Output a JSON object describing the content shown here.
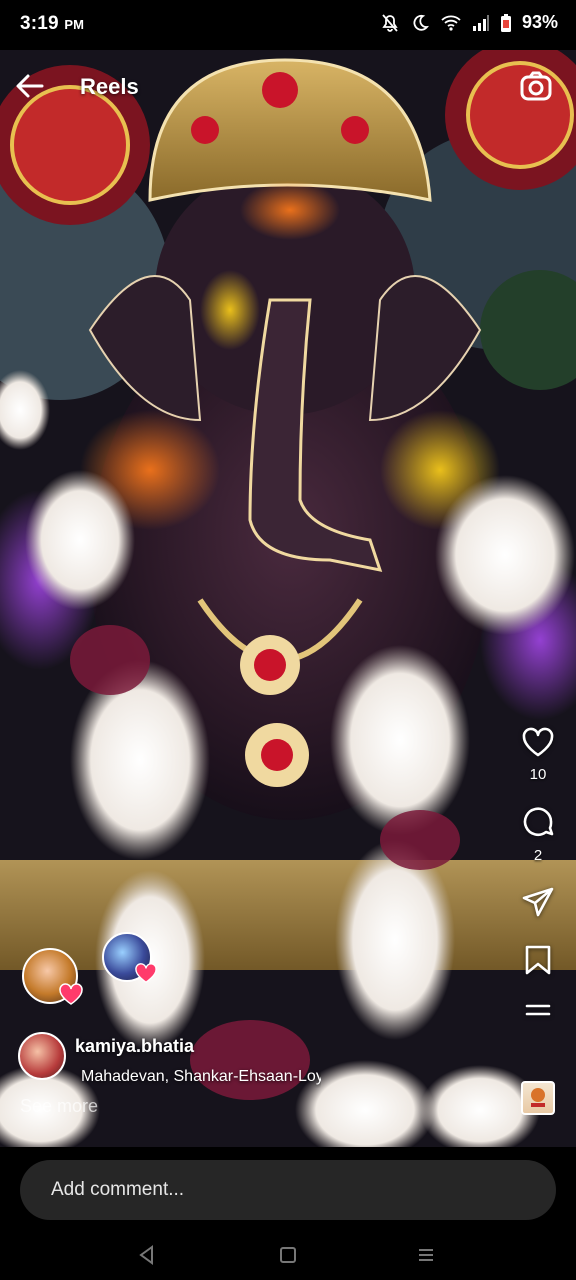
{
  "status_bar": {
    "time": "3:19",
    "ampm": "PM",
    "battery": "93%"
  },
  "header": {
    "title": "Reels",
    "back_icon": "back-arrow-icon",
    "camera_icon": "camera-icon"
  },
  "actions": {
    "likes": "10",
    "comments": "2"
  },
  "post": {
    "username": "kamiya.bhatia",
    "audio": "Mahadevan, Shankar-Ehsaan-Loy",
    "see_more": "See more"
  },
  "comment_box": {
    "placeholder": "Add comment..."
  },
  "colors": {
    "accent_heart": "#ff3b6b",
    "comment_bg": "#262626"
  }
}
